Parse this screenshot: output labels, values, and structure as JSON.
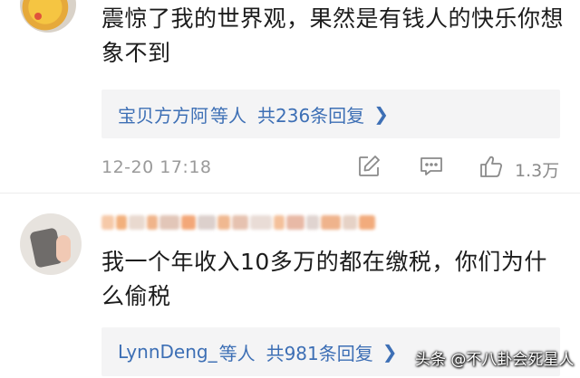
{
  "comments": [
    {
      "text": "震惊了我的世界观，果然是有钱人的快乐你想象不到",
      "replies": {
        "names": "宝贝方方阿",
        "suffix": "等人",
        "count": "共236条回复"
      },
      "timestamp": "12-20 17:18",
      "likes": "1.3万",
      "icons": [
        "edit-icon",
        "comment-icon",
        "thumbs-up-icon"
      ]
    },
    {
      "text": "我一个年收入10多万的都在缴税，你们为什么偷税",
      "replies": {
        "names": "LynnDeng_",
        "suffix": "等人",
        "count": "共981条回复"
      }
    }
  ],
  "watermark": "头条 @不八卦会死星人",
  "colors": {
    "link": "#3d6fb5",
    "box_bg": "#f4f4f5",
    "muted": "#9a9a9a"
  }
}
